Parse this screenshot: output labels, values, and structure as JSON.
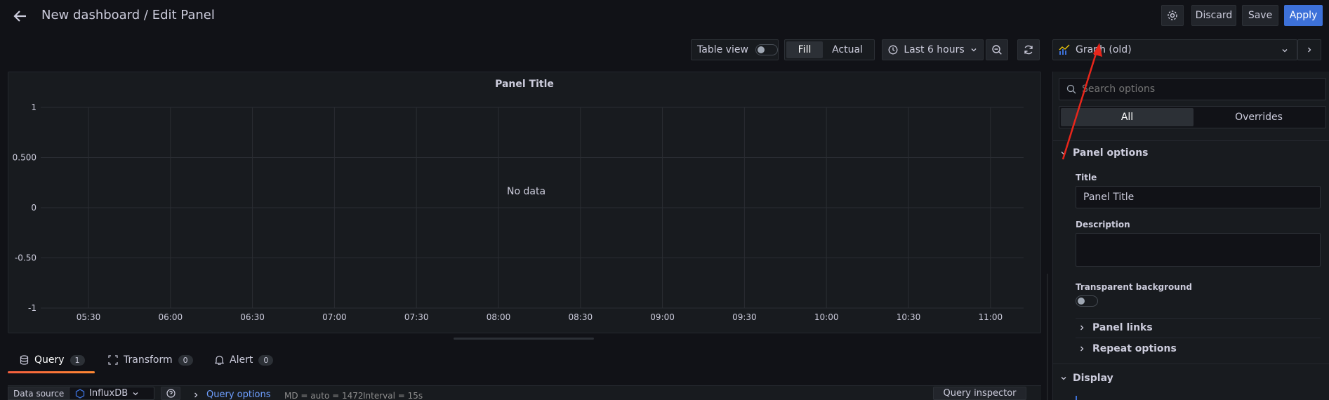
{
  "header": {
    "title": "New dashboard / Edit Panel",
    "discard": "Discard",
    "save": "Save",
    "apply": "Apply"
  },
  "toolbar": {
    "table_view": "Table view",
    "fill": "Fill",
    "actual": "Actual",
    "time_range": "Last 6 hours"
  },
  "viz_picker": {
    "label": "Graph (old)"
  },
  "panel": {
    "title": "Panel Title",
    "no_data": "No data",
    "y_ticks": [
      "1",
      "0.500",
      "0",
      "-0.50",
      "-1"
    ],
    "x_ticks": [
      "05:30",
      "06:00",
      "06:30",
      "07:00",
      "07:30",
      "08:00",
      "08:30",
      "09:00",
      "09:30",
      "10:00",
      "10:30",
      "11:00"
    ]
  },
  "bottom_tabs": [
    {
      "label": "Query",
      "count": "1"
    },
    {
      "label": "Transform",
      "count": "0"
    },
    {
      "label": "Alert",
      "count": "0"
    }
  ],
  "query_row": {
    "datasource_label": "Data source",
    "datasource": "InfluxDB",
    "query_options": "Query options",
    "md": "MD = auto = 1472",
    "interval": "Interval = 15s",
    "inspector": "Query inspector"
  },
  "options": {
    "search_placeholder": "Search options",
    "tab_all": "All",
    "tab_overrides": "Overrides",
    "panel_options": "Panel options",
    "title_label": "Title",
    "title_value": "Panel Title",
    "description_label": "Description",
    "transparent_label": "Transparent background",
    "panel_links": "Panel links",
    "repeat_options": "Repeat options",
    "display": "Display"
  },
  "colors": {
    "accent": "#3d71d9",
    "annotation": "#e8261b",
    "tab_active": "#f55f3e"
  }
}
